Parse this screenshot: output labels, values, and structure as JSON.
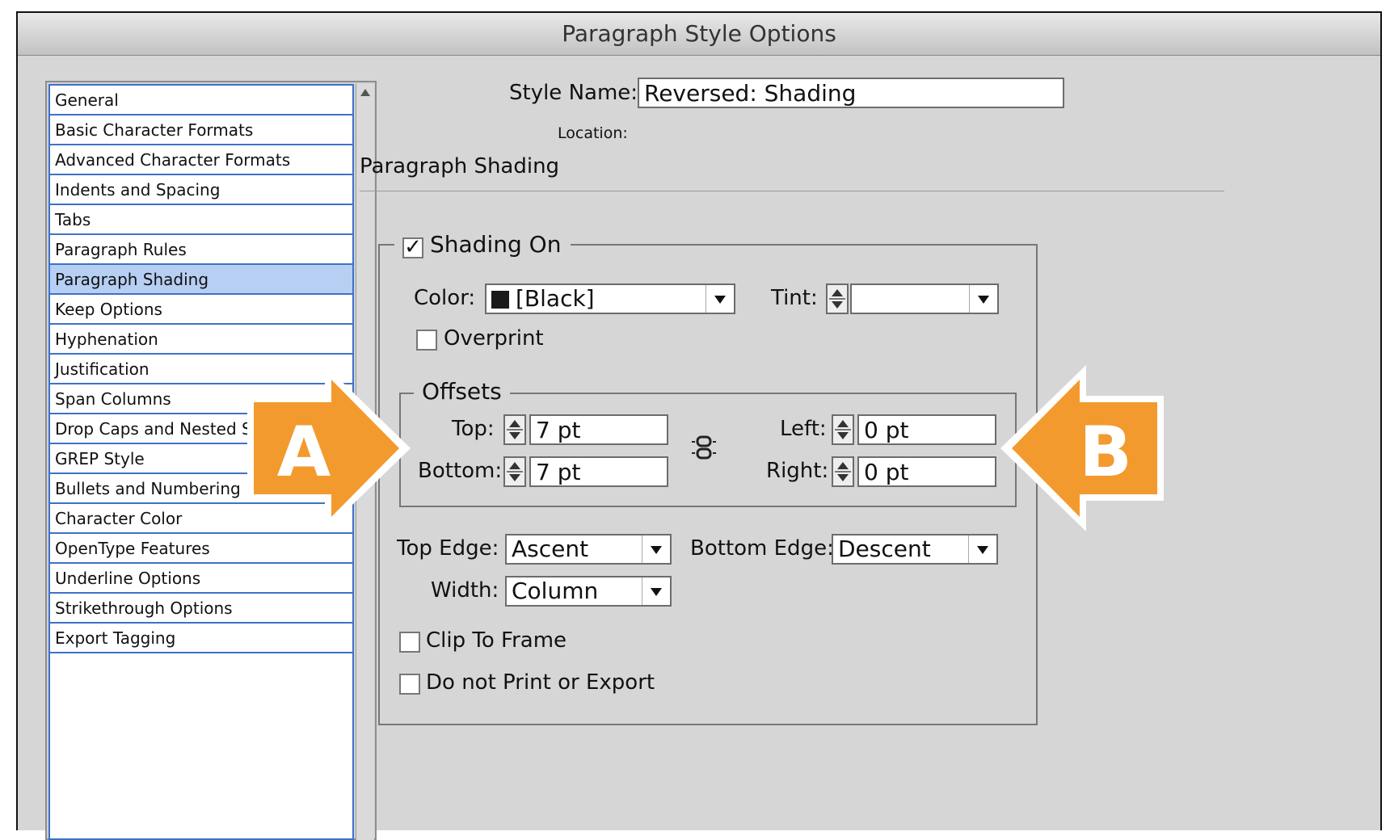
{
  "window": {
    "title": "Paragraph Style Options"
  },
  "sidebar": {
    "items": [
      {
        "label": "General"
      },
      {
        "label": "Basic Character Formats"
      },
      {
        "label": "Advanced Character Formats"
      },
      {
        "label": "Indents and Spacing"
      },
      {
        "label": "Tabs"
      },
      {
        "label": "Paragraph Rules"
      },
      {
        "label": "Paragraph Shading",
        "selected": true
      },
      {
        "label": "Keep Options"
      },
      {
        "label": "Hyphenation"
      },
      {
        "label": "Justification"
      },
      {
        "label": "Span Columns"
      },
      {
        "label": "Drop Caps and Nested Styles"
      },
      {
        "label": "GREP Style"
      },
      {
        "label": "Bullets and Numbering"
      },
      {
        "label": "Character Color"
      },
      {
        "label": "OpenType Features"
      },
      {
        "label": "Underline Options"
      },
      {
        "label": "Strikethrough Options"
      },
      {
        "label": "Export Tagging"
      }
    ]
  },
  "header": {
    "style_name_label": "Style Name:",
    "style_name_value": "Reversed: Shading",
    "location_label": "Location:"
  },
  "section": {
    "title": "Paragraph Shading"
  },
  "shading": {
    "shading_on_label": "Shading On",
    "shading_on_checked": true,
    "color_label": "Color:",
    "color_value": "[Black]",
    "color_swatch": "#1a1a1a",
    "tint_label": "Tint:",
    "tint_value": "",
    "overprint_label": "Overprint",
    "overprint_checked": false
  },
  "offsets": {
    "legend": "Offsets",
    "top_label": "Top:",
    "top_value": "7 pt",
    "bottom_label": "Bottom:",
    "bottom_value": "7 pt",
    "left_label": "Left:",
    "left_value": "0 pt",
    "right_label": "Right:",
    "right_value": "0 pt"
  },
  "edges": {
    "top_edge_label": "Top Edge:",
    "top_edge_value": "Ascent",
    "bottom_edge_label": "Bottom Edge:",
    "bottom_edge_value": "Descent",
    "width_label": "Width:",
    "width_value": "Column"
  },
  "options": {
    "clip_label": "Clip To Frame",
    "clip_checked": false,
    "no_print_label": "Do not Print or Export",
    "no_print_checked": false
  },
  "callouts": {
    "a_label": "A",
    "b_label": "B",
    "color": "#f39a2e"
  },
  "icons": {
    "chain": "chain-link-icon",
    "dropdown": "chevron-down-icon",
    "check": "checkmark-icon"
  }
}
